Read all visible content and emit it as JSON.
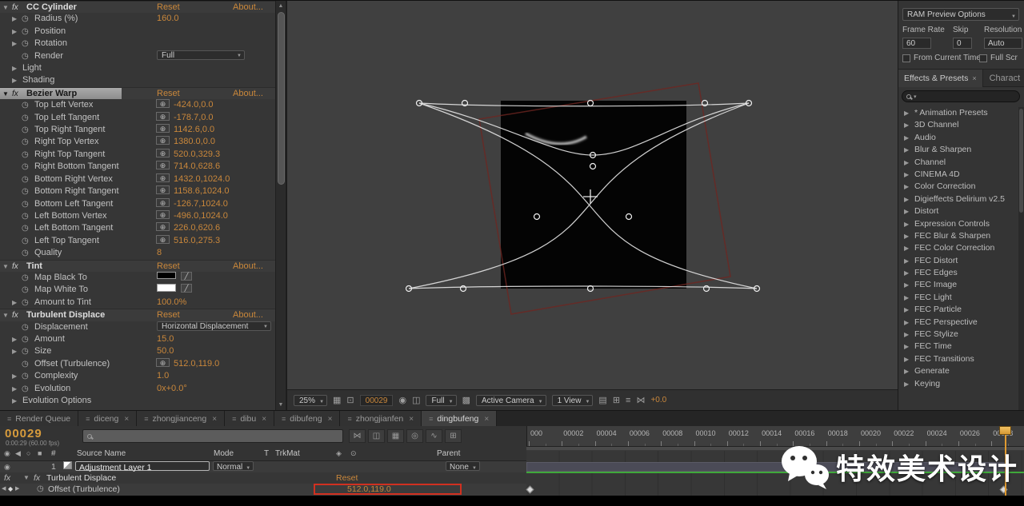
{
  "colors": {
    "value_orange": "#c9873b",
    "selection_gray": "#9a9a9a",
    "green_bar": "#3fa83a",
    "red_highlight": "#d03020"
  },
  "effect_controls": {
    "rows": [
      {
        "type": "header",
        "label": "CC Cylinder",
        "reset": "Reset",
        "about": "About...",
        "selected": false
      },
      {
        "type": "value",
        "label": "Radius (%)",
        "value": "160.0",
        "expand": true
      },
      {
        "type": "plain",
        "label": "Position",
        "expand": true
      },
      {
        "type": "plain",
        "label": "Rotation",
        "expand": true
      },
      {
        "type": "dropdown",
        "label": "Render",
        "value": "Full",
        "wide": false
      },
      {
        "type": "group",
        "label": "Light"
      },
      {
        "type": "group",
        "label": "Shading"
      },
      {
        "type": "header",
        "label": "Bezier Warp",
        "reset": "Reset",
        "about": "About...",
        "selected": true
      },
      {
        "type": "point",
        "label": "Top Left Vertex",
        "value": "-424.0,0.0"
      },
      {
        "type": "point",
        "label": "Top Left Tangent",
        "value": "-178.7,0.0"
      },
      {
        "type": "point",
        "label": "Top Right Tangent",
        "value": "1142.6,0.0"
      },
      {
        "type": "point",
        "label": "Right Top Vertex",
        "value": "1380.0,0.0"
      },
      {
        "type": "point",
        "label": "Right Top Tangent",
        "value": "520.0,329.3"
      },
      {
        "type": "point",
        "label": "Right Bottom Tangent",
        "value": "714.0,628.6"
      },
      {
        "type": "point",
        "label": "Bottom Right Vertex",
        "value": "1432.0,1024.0"
      },
      {
        "type": "point",
        "label": "Bottom Right Tangent",
        "value": "1158.6,1024.0"
      },
      {
        "type": "point",
        "label": "Bottom Left Tangent",
        "value": "-126.7,1024.0"
      },
      {
        "type": "point",
        "label": "Left Bottom Vertex",
        "value": "-496.0,1024.0"
      },
      {
        "type": "point",
        "label": "Left Bottom Tangent",
        "value": "226.0,620.6"
      },
      {
        "type": "point",
        "label": "Left Top Tangent",
        "value": "516.0,275.3"
      },
      {
        "type": "value",
        "label": "Quality",
        "value": "8",
        "expand": false
      },
      {
        "type": "header",
        "label": "Tint",
        "reset": "Reset",
        "about": "About...",
        "selected": false
      },
      {
        "type": "color",
        "label": "Map Black To",
        "swatch": "#000000"
      },
      {
        "type": "color",
        "label": "Map White To",
        "swatch": "#ffffff"
      },
      {
        "type": "value",
        "label": "Amount to Tint",
        "value": "100.0%",
        "expand": true
      },
      {
        "type": "header",
        "label": "Turbulent Displace",
        "reset": "Reset",
        "about": "About...",
        "selected": false
      },
      {
        "type": "dropdown",
        "label": "Displacement",
        "value": "Horizontal Displacement",
        "wide": true
      },
      {
        "type": "value",
        "label": "Amount",
        "value": "15.0",
        "expand": true
      },
      {
        "type": "value",
        "label": "Size",
        "value": "50.0",
        "expand": true
      },
      {
        "type": "point",
        "label": "Offset (Turbulence)",
        "value": "512.0,119.0"
      },
      {
        "type": "value",
        "label": "Complexity",
        "value": "1.0",
        "expand": true
      },
      {
        "type": "value",
        "label": "Evolution",
        "value": "0x+0.0°",
        "expand": true
      },
      {
        "type": "group",
        "label": "Evolution Options"
      }
    ]
  },
  "viewer": {
    "toolbar": {
      "zoom": "25%",
      "frame": "00029",
      "channel": "Full",
      "camera": "Active Camera",
      "view_layout": "1 View",
      "exposure": "+0.0"
    }
  },
  "preview_panel": {
    "dropdown": "RAM Preview Options",
    "labels": [
      "Frame Rate",
      "Skip",
      "Resolution"
    ],
    "frame_rate": "60",
    "skip": "0",
    "resolution": "Auto",
    "checkbox1": "From Current Time",
    "checkbox2": "Full Scr"
  },
  "effects_presets": {
    "tab": "Effects & Presets",
    "tab_close": "×",
    "tab2": "Charact",
    "items": [
      "* Animation Presets",
      "3D Channel",
      "Audio",
      "Blur & Sharpen",
      "Channel",
      "CINEMA 4D",
      "Color Correction",
      "Digieffects Delirium v2.5",
      "Distort",
      "Expression Controls",
      "FEC Blur & Sharpen",
      "FEC Color Correction",
      "FEC Distort",
      "FEC Edges",
      "FEC Image",
      "FEC Light",
      "FEC Particle",
      "FEC Perspective",
      "FEC Stylize",
      "FEC Time",
      "FEC Transitions",
      "Generate",
      "Keying"
    ]
  },
  "timeline": {
    "tabs": [
      {
        "label": "Render Queue",
        "close": false,
        "active": false
      },
      {
        "label": "diceng",
        "close": true,
        "active": false
      },
      {
        "label": "zhongjianceng",
        "close": true,
        "active": false
      },
      {
        "label": "dibu",
        "close": true,
        "active": false
      },
      {
        "label": "dibufeng",
        "close": true,
        "active": false
      },
      {
        "label": "zhongjianfen",
        "close": true,
        "active": false
      },
      {
        "label": "dingbufeng",
        "close": true,
        "active": true
      }
    ],
    "current_frame": "00029",
    "time_display": "0:00:29 (60.00 fps)",
    "ruler": [
      "000",
      "00002",
      "00004",
      "00006",
      "00008",
      "00010",
      "00012",
      "00014",
      "00016",
      "00018",
      "00020",
      "00022",
      "00024",
      "00026",
      "00028"
    ],
    "headers": {
      "hash": "#",
      "source_name": "Source Name",
      "mode": "Mode",
      "t": "T",
      "trkmat": "TrkMat",
      "parent": "Parent"
    },
    "layer": {
      "index": "1",
      "name": "Adjustment Layer 1",
      "mode": "Normal",
      "parent": "None"
    },
    "effect_row": {
      "name": "Turbulent Displace",
      "reset": "Reset"
    },
    "property_row": {
      "name": "Offset (Turbulence)",
      "value": "512.0,119.0"
    }
  },
  "watermark": {
    "text": "特效美术设计"
  }
}
